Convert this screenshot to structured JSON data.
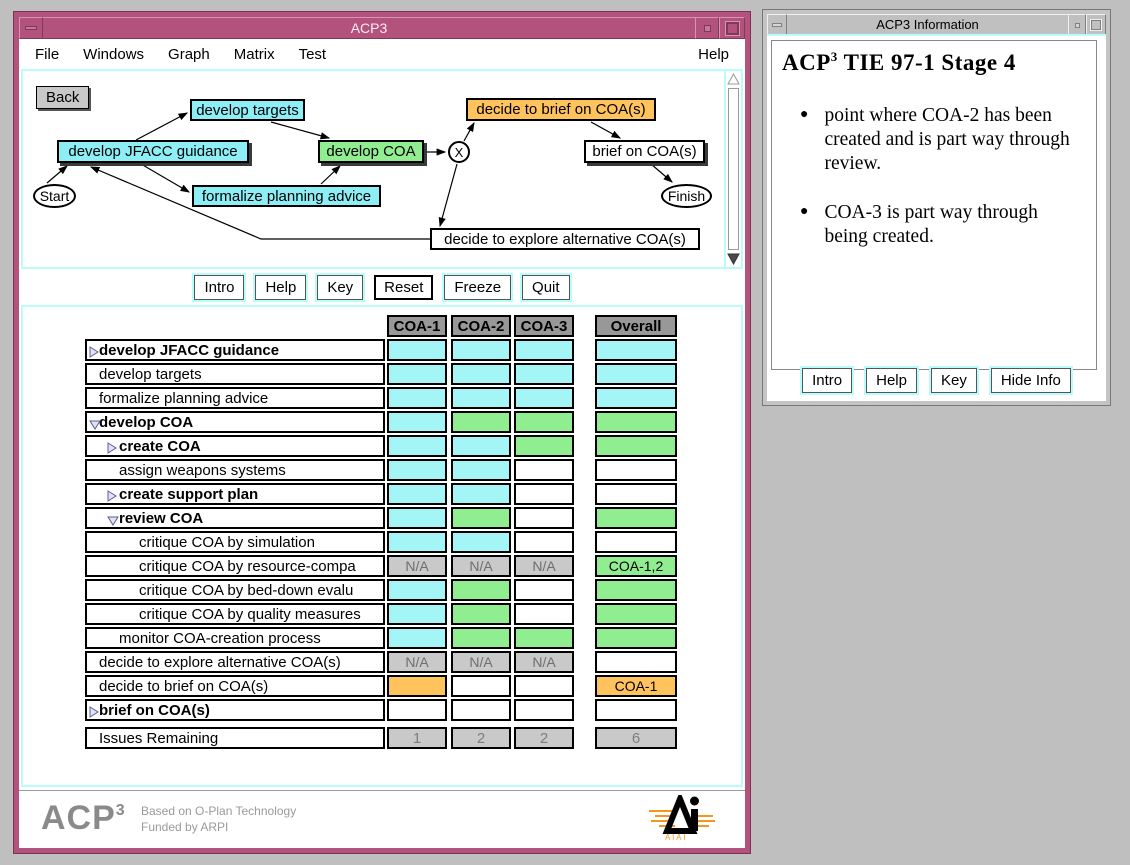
{
  "colors": {
    "pink": "#b3537d",
    "highlight_cyan": "#b8fcfc",
    "cell_cyan": "#a4f6f6",
    "node_cyan": "#8deef6",
    "green": "#90ee90",
    "orange": "#ffc35e",
    "na_gray": "#c9c9c9",
    "header_gray": "#989898"
  },
  "main_window": {
    "title": "ACP3",
    "menu": [
      "File",
      "Windows",
      "Graph",
      "Matrix",
      "Test"
    ],
    "menu_help": "Help",
    "graph": {
      "back_label": "Back",
      "start_label": "Start",
      "finish_label": "Finish",
      "xor_label": "X",
      "nodes": [
        {
          "label": "develop targets",
          "color": "cyan"
        },
        {
          "label": "decide to brief on COA(s)",
          "color": "orange"
        },
        {
          "label": "develop JFACC guidance",
          "color": "cyan"
        },
        {
          "label": "develop COA",
          "color": "green"
        },
        {
          "label": "brief on COA(s)",
          "color": "white"
        },
        {
          "label": "formalize planning advice",
          "color": "cyan"
        },
        {
          "label": "decide to explore alternative COA(s)",
          "color": "white"
        }
      ]
    },
    "buttons": [
      "Intro",
      "Help",
      "Key",
      "Reset",
      "Freeze",
      "Quit"
    ],
    "default_button": "Reset",
    "matrix": {
      "columns": [
        "COA-1",
        "COA-2",
        "COA-3",
        "Overall"
      ],
      "rows": [
        {
          "label": "develop JFACC guidance",
          "bold": true,
          "level": 0,
          "expander": "right",
          "cells": [
            "c",
            "c",
            "c"
          ],
          "overall": "c"
        },
        {
          "label": "develop targets",
          "bold": false,
          "level": 0,
          "expander": null,
          "cells": [
            "c",
            "c",
            "c"
          ],
          "overall": "c"
        },
        {
          "label": "formalize planning advice",
          "bold": false,
          "level": 0,
          "expander": null,
          "cells": [
            "c",
            "c",
            "c"
          ],
          "overall": "c"
        },
        {
          "label": "develop COA",
          "bold": true,
          "level": 0,
          "expander": "down",
          "cells": [
            "c",
            "g",
            "g"
          ],
          "overall": "g"
        },
        {
          "label": "create COA",
          "bold": true,
          "level": 1,
          "expander": "right",
          "cells": [
            "c",
            "c",
            "g"
          ],
          "overall": "g"
        },
        {
          "label": "assign weapons systems",
          "bold": false,
          "level": 1,
          "expander": null,
          "cells": [
            "c",
            "c",
            "w"
          ],
          "overall": "w"
        },
        {
          "label": "create support plan",
          "bold": true,
          "level": 1,
          "expander": "right",
          "cells": [
            "c",
            "c",
            "w"
          ],
          "overall": "w"
        },
        {
          "label": "review COA",
          "bold": true,
          "level": 1,
          "expander": "down",
          "cells": [
            "c",
            "g",
            "w"
          ],
          "overall": "g"
        },
        {
          "label": "critique COA by simulation",
          "bold": false,
          "level": 2,
          "expander": null,
          "cells": [
            "c",
            "c",
            "w"
          ],
          "overall": "w"
        },
        {
          "label": "critique COA by resource-compa",
          "bold": false,
          "level": 2,
          "expander": null,
          "cells": [
            "na",
            "na",
            "na"
          ],
          "overall": {
            "text": "COA-1,2",
            "color": "g"
          }
        },
        {
          "label": "critique COA by bed-down evalu",
          "bold": false,
          "level": 2,
          "expander": null,
          "cells": [
            "c",
            "g",
            "w"
          ],
          "overall": "g"
        },
        {
          "label": "critique COA by quality measures",
          "bold": false,
          "level": 2,
          "expander": null,
          "cells": [
            "c",
            "g",
            "w"
          ],
          "overall": "g"
        },
        {
          "label": "monitor COA-creation process",
          "bold": false,
          "level": 1,
          "expander": null,
          "cells": [
            "c",
            "g",
            "g"
          ],
          "overall": "g"
        },
        {
          "label": "decide to explore alternative COA(s)",
          "bold": false,
          "level": 0,
          "expander": null,
          "cells": [
            "na",
            "na",
            "na"
          ],
          "overall": "w"
        },
        {
          "label": "decide to brief on COA(s)",
          "bold": false,
          "level": 0,
          "expander": null,
          "cells": [
            "o",
            "w",
            "w"
          ],
          "overall": {
            "text": "COA-1",
            "color": "o"
          }
        },
        {
          "label": "brief on COA(s)",
          "bold": true,
          "level": 0,
          "expander": "right",
          "cells": [
            "w",
            "w",
            "w"
          ],
          "overall": "w"
        }
      ],
      "na_text": "N/A",
      "issues": {
        "label": "Issues Remaining",
        "values": [
          "1",
          "2",
          "2",
          "6"
        ]
      }
    },
    "footer": {
      "logo": "ACP",
      "logo_sup": "3",
      "line1": "Based on O-Plan Technology",
      "line2": "Funded by ARPI",
      "aiai_caption": "A I A I"
    }
  },
  "info_window": {
    "title": "ACP3 Information",
    "heading_prefix": "ACP",
    "heading_sup": "3",
    "heading_rest": " TIE 97-1 Stage 4",
    "bullets": [
      "point where COA-2 has been created and is part way through review.",
      "COA-3 is part way through being created."
    ],
    "buttons": [
      "Intro",
      "Help",
      "Key",
      "Hide Info"
    ]
  }
}
